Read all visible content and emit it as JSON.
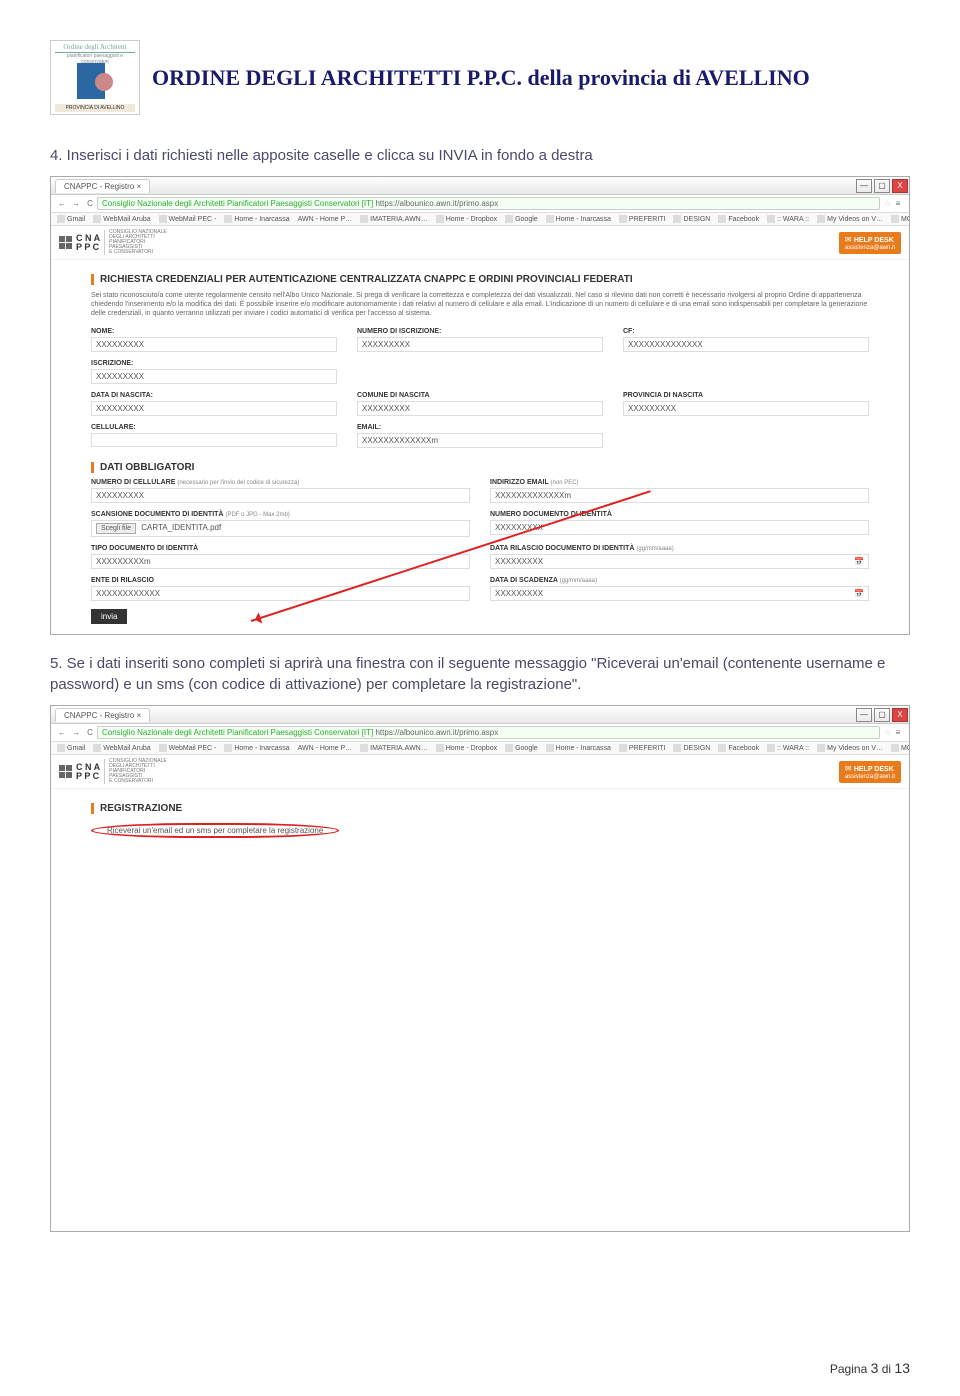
{
  "header": {
    "logo_top": "Ordine degli Architetti",
    "logo_sub": "pianificatori paesaggisti e conservatori",
    "logo_bottom": "PROVINCIA DI AVELLINO",
    "title": "ORDINE DEGLI ARCHITETTI P.P.C. della provincia di AVELLINO"
  },
  "instructions": {
    "step4": "4. Inserisci i dati richiesti nelle apposite caselle e clicca su INVIA in fondo a destra",
    "step5": "5. Se i dati inseriti sono completi si aprirà una finestra con il seguente messaggio \"Riceverai un'email (contenente username e password) e un sms (con codice di attivazione) per completare la registrazione\"."
  },
  "browser": {
    "tab_title": "CNAPPC - Registro ×",
    "url_prefix": "Consiglio Nazionale degli Architetti Pianificatori Paesaggisti Conservatori [IT]",
    "url": "https://albounico.awn.it/primo.aspx",
    "bookmarks": [
      "Gmail",
      "WebMail Aruba",
      "WebMail PEC -",
      "Home - Inarcassa",
      "AWN - Home P…",
      "IMATERIA.AWN…",
      "Home - Dropbox",
      "Google",
      "Home - Inarcassa",
      "PREFERITI",
      "DESIGN",
      "Facebook",
      ":: WARA ::",
      "My Videos on V…",
      "MOOC Moodle…"
    ],
    "back": "←",
    "fwd": "→",
    "reload": "C",
    "min": "—",
    "max": "▢",
    "close": "X",
    "more": "»"
  },
  "app": {
    "logo_line1": "C N A",
    "logo_line2": "P P C",
    "logo_sub1": "CONSIGLIO NAZIONALE",
    "logo_sub2": "DEGLI ARCHITETTI",
    "logo_sub3": "PIANIFICATORI",
    "logo_sub4": "PAESAGGISTI",
    "logo_sub5": "E CONSERVATORI",
    "help_desk": "HELP DESK",
    "help_mail": "assistenza@awn.it"
  },
  "form1": {
    "title": "RICHIESTA CREDENZIALI PER AUTENTICAZIONE CENTRALIZZATA CNAPPC E ORDINI PROVINCIALI FEDERATI",
    "intro": "Sei stato riconosciuto/a come utente regolarmente censito nell'Albo Unico Nazionale. Si prega di verificare la correttezza e completezza dei dati visualizzati. Nel caso si rilevino dati non corretti è necessario rivolgersi al proprio Ordine di appartenenza chiedendo l'inserimento e/o la modifica dei dati. È possibile inserire e/o modificare autonomamente i dati relativi al numero di cellulare e alla email. L'indicazione di un numero di cellulare e di una email sono indispensabili per completare la generazione delle credenziali, in quanto verranno utilizzati per inviare i codici automatici di verifica per l'accesso al sistema.",
    "fields": {
      "nome": {
        "label": "NOME:",
        "value": "XXXXXXXXX"
      },
      "num_iscr": {
        "label": "NUMERO DI ISCRIZIONE:",
        "value": "XXXXXXXXX"
      },
      "cf": {
        "label": "CF:",
        "value": "XXXXXXXXXXXXXX"
      },
      "iscrizione": {
        "label": "ISCRIZIONE:",
        "value": "XXXXXXXXX"
      },
      "data_nascita": {
        "label": "DATA DI NASCITA:",
        "value": "XXXXXXXXX"
      },
      "comune_nascita": {
        "label": "COMUNE DI NASCITA",
        "value": "XXXXXXXXX"
      },
      "prov_nascita": {
        "label": "PROVINCIA DI NASCITA",
        "value": "XXXXXXXXX"
      },
      "cellulare": {
        "label": "CELLULARE:",
        "value": ""
      },
      "email": {
        "label": "EMAIL:",
        "value": "XXXXXXXXXXXXXm"
      }
    },
    "obbl_title": "DATI OBBLIGATORI",
    "obbl": {
      "num_cell": {
        "label": "NUMERO DI CELLULARE",
        "sub": "(necessario per l'invio del codice di sicurezza)",
        "value": "XXXXXXXXX"
      },
      "ind_email": {
        "label": "INDIRIZZO EMAIL",
        "sub": "(non PEC)",
        "value": "XXXXXXXXXXXXXm"
      },
      "scans": {
        "label": "SCANSIONE DOCUMENTO DI IDENTITÀ",
        "sub": "(PDF o JPG - Max 2mb)",
        "btn": "Scegli file",
        "file": "CARTA_IDENTITA.pdf"
      },
      "num_doc": {
        "label": "NUMERO DOCUMENTO DI IDENTITÀ",
        "value": "XXXXXXXXX"
      },
      "tipo_doc": {
        "label": "TIPO DOCUMENTO DI IDENTITÀ",
        "value": "XXXXXXXXXm"
      },
      "data_ril": {
        "label": "DATA RILASCIO DOCUMENTO DI IDENTITÀ",
        "sub": "(gg/mm/aaaa)",
        "value": "XXXXXXXXX"
      },
      "ente": {
        "label": "ENTE DI RILASCIO",
        "value": "XXXXXXXXXXXX"
      },
      "data_scad": {
        "label": "DATA DI SCADENZA",
        "sub": "(gg/mm/aaaa)",
        "value": "XXXXXXXXX"
      }
    },
    "invia": "invia"
  },
  "form2": {
    "title": "REGISTRAZIONE",
    "msg": "Riceverai un'email ed un sms per completare la registrazione"
  },
  "footer": {
    "label": "Pagina",
    "page": "3",
    "sep": "di",
    "total": "13"
  }
}
